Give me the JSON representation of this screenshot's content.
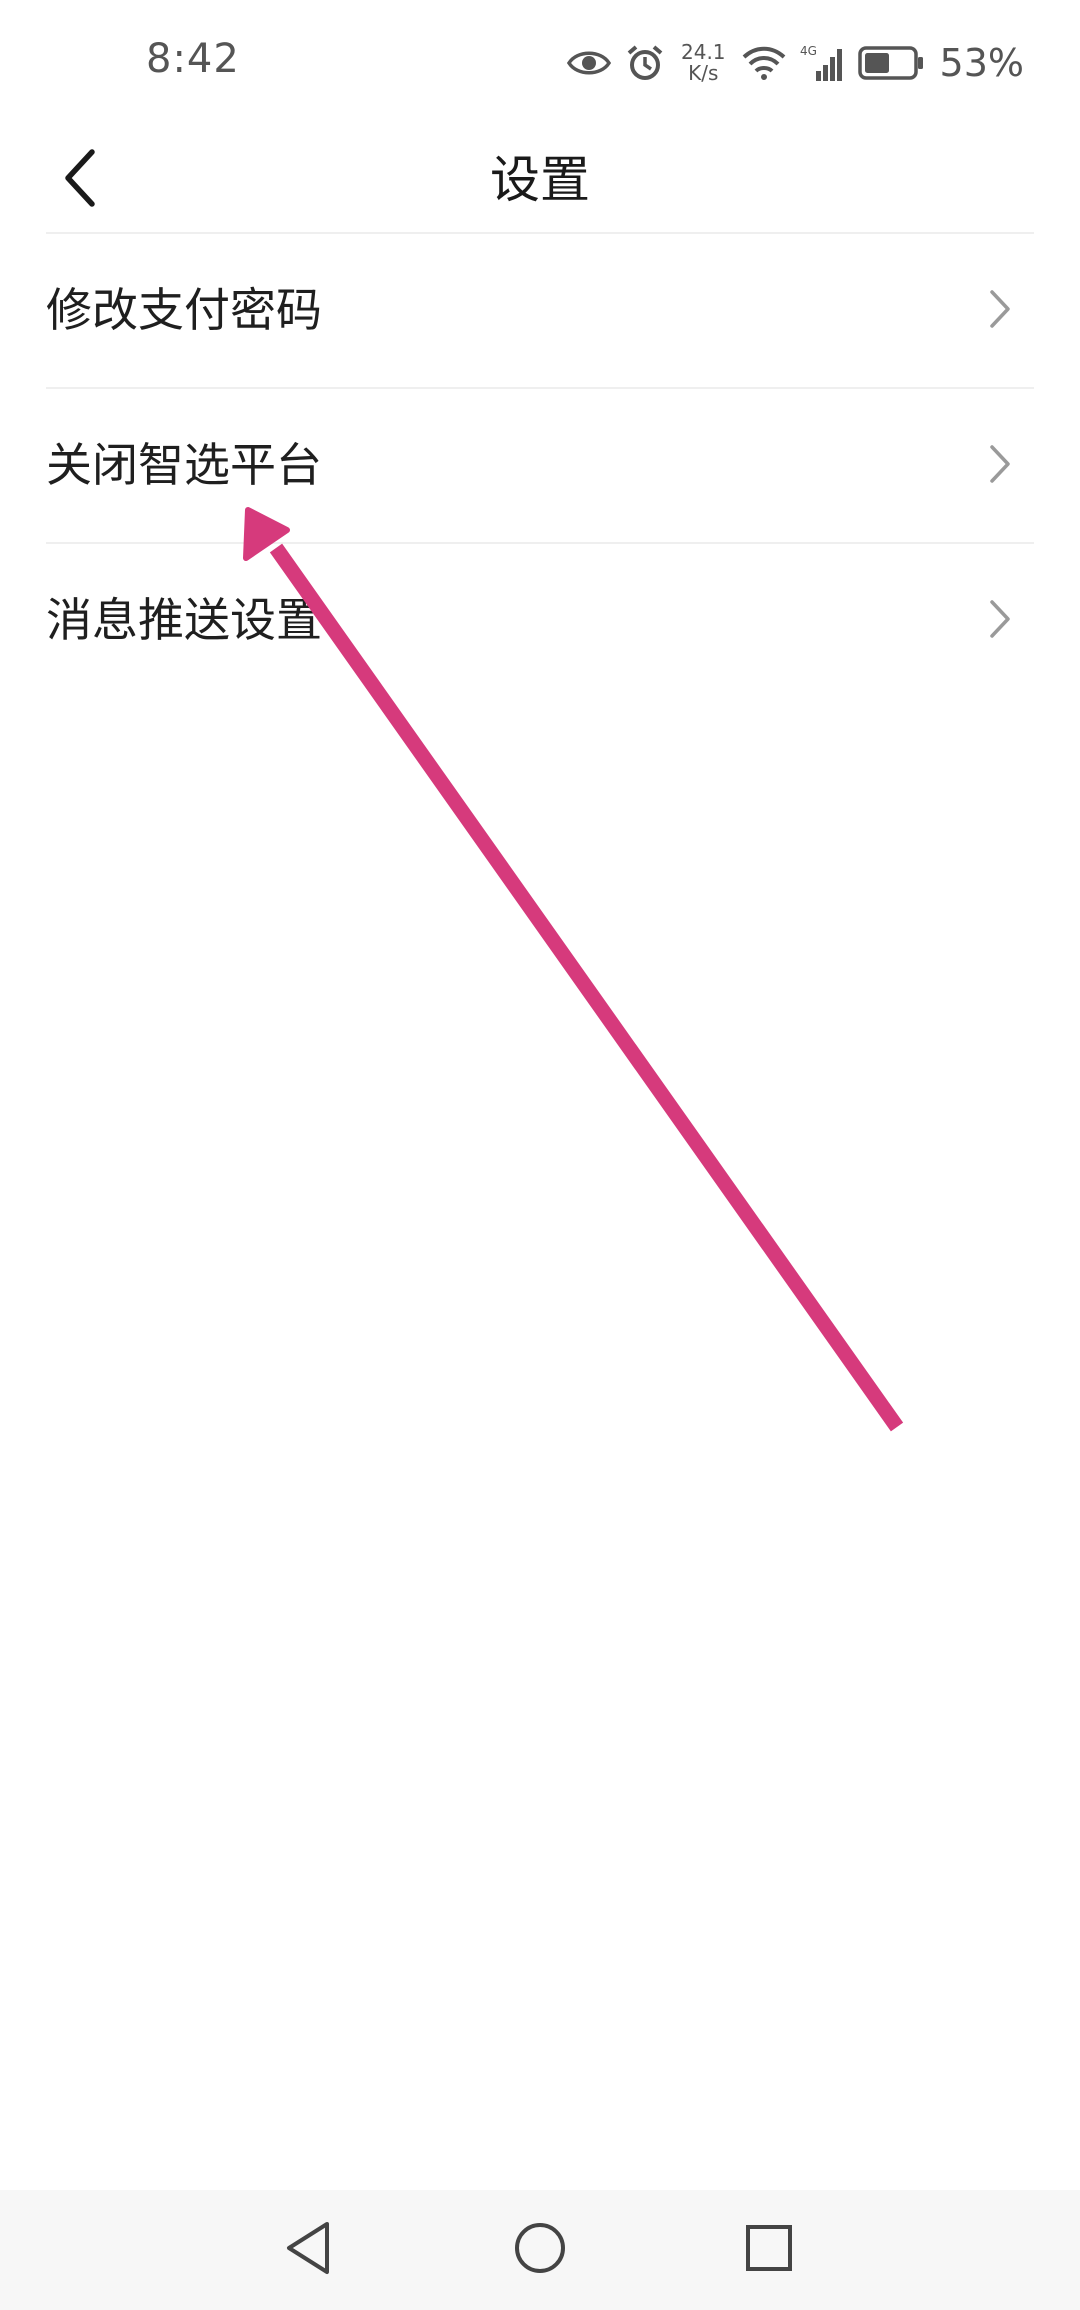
{
  "status_bar": {
    "time": "8:42",
    "net_speed_value": "24.1",
    "net_speed_unit": "K/s",
    "network_type": "4G",
    "battery_percent": "53%",
    "icons": [
      "eye-icon",
      "alarm-icon",
      "wifi-icon",
      "signal-icon",
      "battery-icon"
    ],
    "battery_level": 0.53
  },
  "header": {
    "title": "设置",
    "back_icon": "chevron-left-icon"
  },
  "settings": {
    "items": [
      {
        "label": "修改支付密码"
      },
      {
        "label": "关闭智选平台"
      },
      {
        "label": "消息推送设置"
      }
    ],
    "chevron_icon": "chevron-right-icon"
  },
  "annotation": {
    "type": "arrow",
    "color": "#d63a7c",
    "points_to": "关闭智选平台"
  },
  "nav_bar": {
    "buttons": [
      "back-triangle-icon",
      "home-circle-icon",
      "recents-square-icon"
    ]
  },
  "colors": {
    "background": "#ffffff",
    "text": "#1f1f1f",
    "divider": "#efefef",
    "chevron": "#9a9a9a",
    "nav_background": "#f7f7f7",
    "annotation": "#d63a7c"
  }
}
